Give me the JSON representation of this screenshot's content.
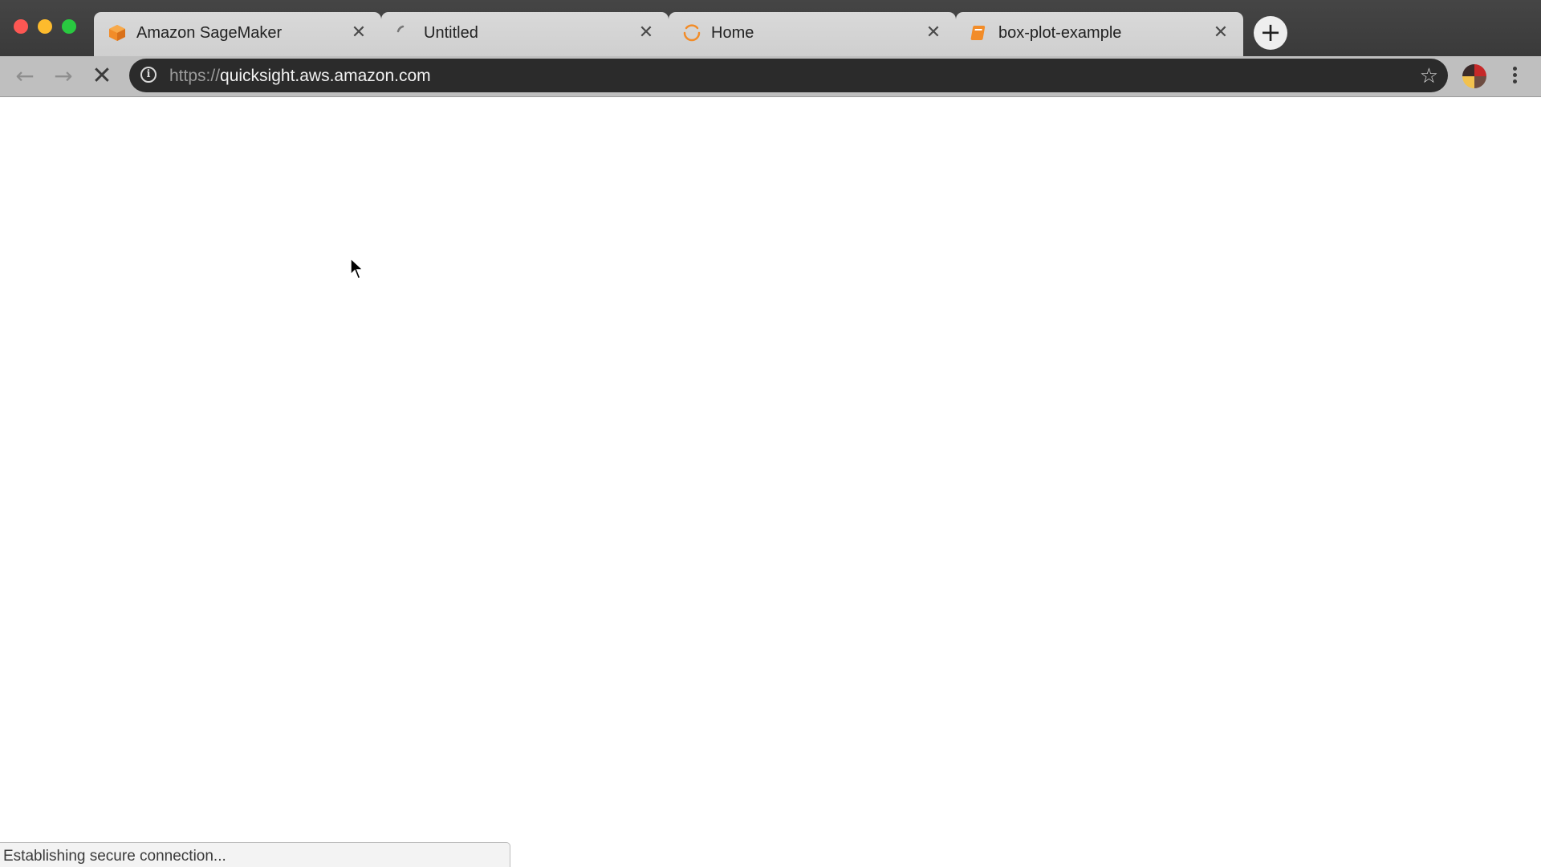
{
  "tabs": [
    {
      "title": "Amazon SageMaker",
      "active": false,
      "favicon": "sagemaker-cube-icon"
    },
    {
      "title": "Untitled",
      "active": false,
      "favicon": "loading-spinner-icon"
    },
    {
      "title": "Home",
      "active": false,
      "favicon": "loading-spinner-icon"
    },
    {
      "title": "box-plot-example",
      "active": false,
      "favicon": "jupyter-notebook-icon"
    }
  ],
  "toolbar": {
    "url_scheme": "https://",
    "url_host": "quicksight.aws.amazon.com"
  },
  "status": {
    "text": "Establishing secure connection..."
  },
  "colors": {
    "close_light": "#fd5753",
    "minimize_light": "#fdbb2d",
    "maximize_light": "#29c940",
    "favicon_orange": "#f28c28",
    "omnibox_bg": "#2b2b2b"
  }
}
